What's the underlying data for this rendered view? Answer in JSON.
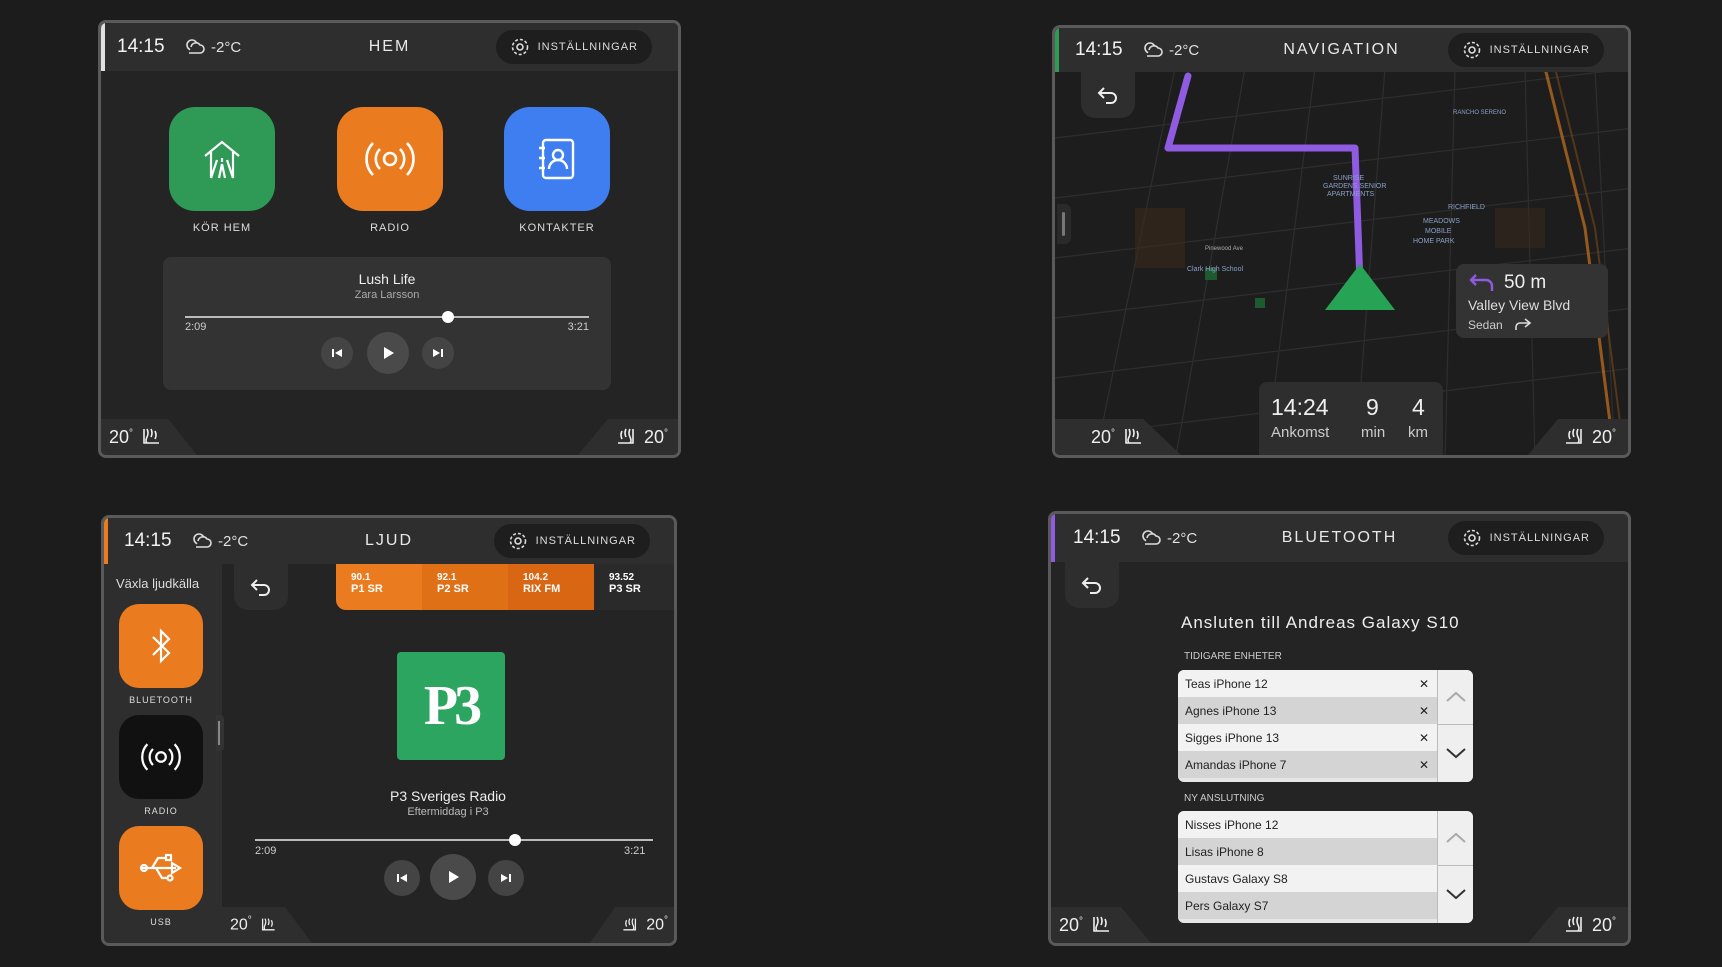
{
  "status": {
    "time": "14:15",
    "temperature": "-2°C",
    "settings_label": "INSTÄLLNINGAR"
  },
  "climate": {
    "left_temp": "20",
    "right_temp": "20",
    "degree": "°"
  },
  "home": {
    "title": "HEM",
    "apps": [
      {
        "label": "KÖR HEM",
        "color": "#2e9a55"
      },
      {
        "label": "RADIO",
        "color": "#ea7b1e"
      },
      {
        "label": "KONTAKTER",
        "color": "#3f7ef0"
      }
    ],
    "player": {
      "track": "Lush Life",
      "artist": "Zara Larsson",
      "elapsed": "2:09",
      "duration": "3:21",
      "progress": 0.65
    }
  },
  "navigation": {
    "title": "NAVIGATION",
    "map_labels": [
      "SUNRISE GARDENS SENIOR APARTMENTS",
      "MEADOWS MOBILE HOME PARK",
      "RICHFIELD",
      "RANCHO SERENO",
      "Clark High School",
      "Pinewood Ave"
    ],
    "turn": {
      "distance": "50 m",
      "street": "Valley View Blvd",
      "next": "Sedan"
    },
    "eta": {
      "arrival_time": "14:24",
      "arrival_label": "Ankomst",
      "minutes": "9",
      "minutes_unit": "min",
      "distance": "4",
      "distance_unit": "km"
    },
    "route_color": "#8f5be0"
  },
  "audio": {
    "title": "LJUD",
    "source_header": "Växla ljudkälla",
    "sources": [
      {
        "label": "BLUETOOTH",
        "color": "#ea7b1e"
      },
      {
        "label": "RADIO",
        "color": "#111111"
      },
      {
        "label": "USB",
        "color": "#ea7b1e"
      }
    ],
    "stations": [
      {
        "freq": "90.1",
        "name": "P1 SR"
      },
      {
        "freq": "92.1",
        "name": "P2 SR"
      },
      {
        "freq": "104.2",
        "name": "RIX FM"
      },
      {
        "freq": "93.52",
        "name": "P3 SR"
      }
    ],
    "logo_text": "P3",
    "station_name": "P3 Sveriges Radio",
    "program": "Eftermiddag i P3",
    "elapsed": "2:09",
    "duration": "3:21",
    "progress": 0.65
  },
  "bluetooth": {
    "title": "BLUETOOTH",
    "connected_to": "Ansluten till Andreas Galaxy S10",
    "previous_header": "TIDIGARE ENHETER",
    "previous": [
      "Teas iPhone 12",
      "Agnes iPhone 13",
      "Sigges iPhone 13",
      "Amandas iPhone 7"
    ],
    "new_header": "NY ANSLUTNING",
    "new": [
      "Nisses iPhone 12",
      "Lisas iPhone 8",
      "Gustavs Galaxy S8",
      "Pers Galaxy S7"
    ]
  }
}
